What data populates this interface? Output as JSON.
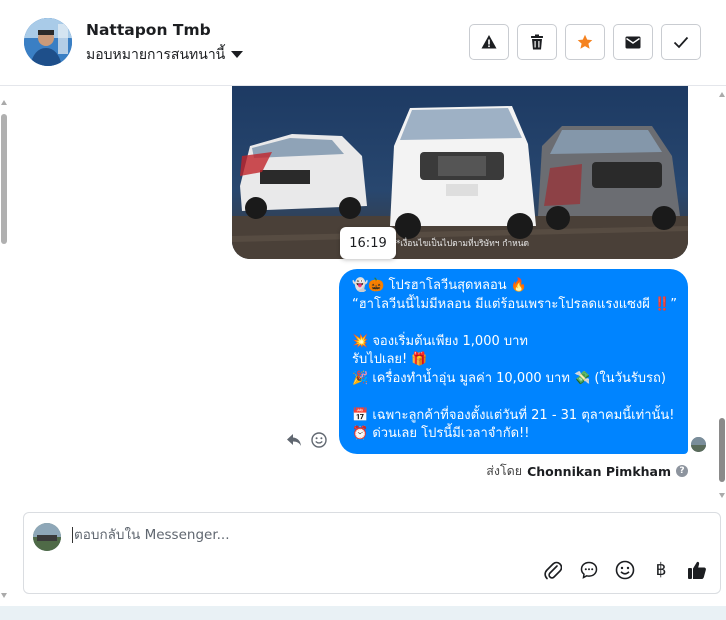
{
  "header": {
    "name": "Nattapon Tmb",
    "assign_label": "มอบหมายการสนทนานี้",
    "actions": [
      "warning-icon",
      "trash-icon",
      "star-icon",
      "envelope-icon",
      "check-icon"
    ],
    "star_color": "#f5821f"
  },
  "thread": {
    "image_caption": "*เงื่อนไขเป็นไปตามที่บริษัทฯ กำหนด",
    "image_time": "16:19",
    "message_lines": [
      "👻🎃 โปรฮาโลวีนสุดหลอน 🔥",
      "“ฮาโลวีนนี้ไม่มีหลอน มีแต่ร้อนเพราะโปรลดแรงแซงผี ‼️”",
      "",
      "💥 จองเริ่มต้นเพียง 1,000 บาท",
      "รับไปเลย! 🎁",
      "🎉 เครื่องทำน้ำอุ่น มูลค่า 10,000 บาท 💸 (ในวันรับรถ)",
      "",
      "📅 เฉพาะลูกค้าที่จองตั้งแต่วันที่ 21 - 31 ตุลาคมนี้เท่านั้น!",
      "⏰ ด่วนเลย โปรนี้มีเวลาจำกัด!!"
    ],
    "sent_by_prefix": "ส่งโดย",
    "sent_by_name": "Chonnikan Pimkham",
    "bubble_color": "#0084ff"
  },
  "composer": {
    "placeholder": "ตอบกลับใน Messenger...",
    "tools": [
      "paperclip-icon",
      "chat-bubble-icon",
      "smiley-icon",
      "baht-icon",
      "thumbs-up-icon"
    ],
    "baht_symbol": "฿"
  }
}
